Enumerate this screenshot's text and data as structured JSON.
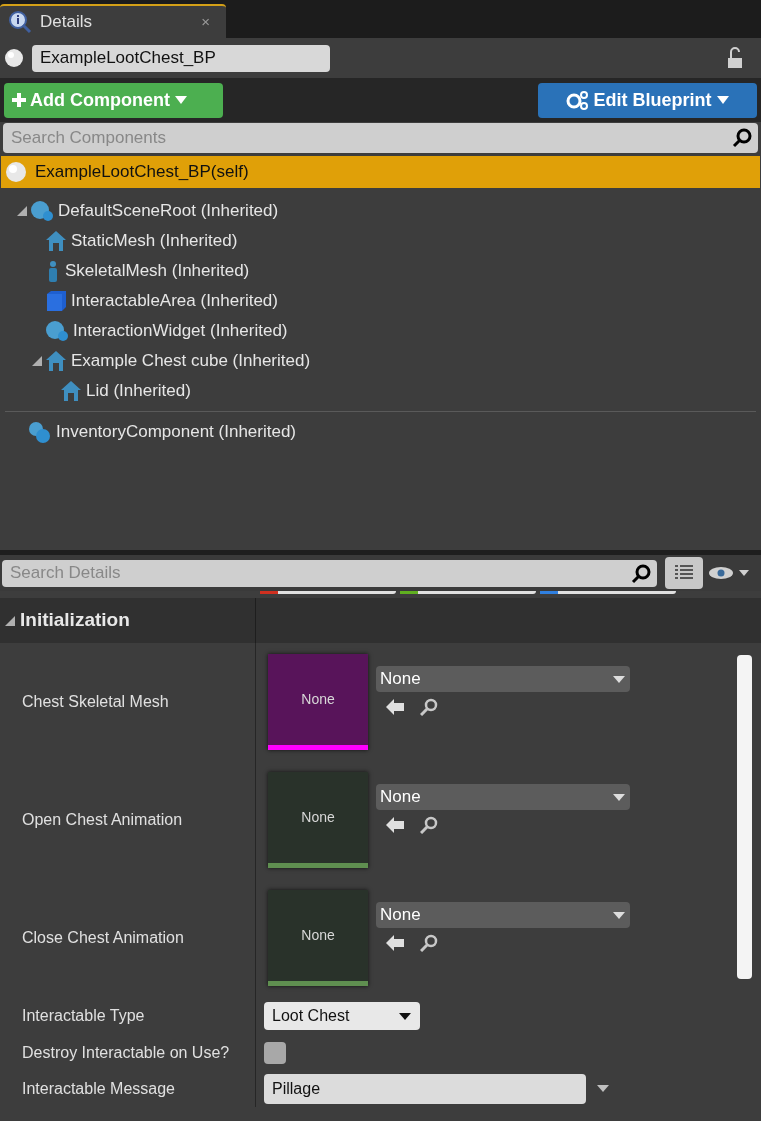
{
  "tab": {
    "title": "Details",
    "close": "×"
  },
  "object_name": {
    "value": "ExampleLootChest_BP",
    "locked": false
  },
  "add_button": {
    "label": "Add Component"
  },
  "edit_button": {
    "label": "Edit Blueprint"
  },
  "component_search": {
    "placeholder": "Search Components"
  },
  "self_row": {
    "label": "ExampleLootChest_BP(self)",
    "selected": true
  },
  "tree": [
    {
      "label": "DefaultSceneRoot (Inherited)",
      "kind": "sphere",
      "expanded": true,
      "children": [
        {
          "label": "StaticMesh (Inherited)",
          "kind": "mesh"
        },
        {
          "label": "SkeletalMesh (Inherited)",
          "kind": "skeletal"
        },
        {
          "label": "InteractableArea (Inherited)",
          "kind": "box"
        },
        {
          "label": "InteractionWidget (Inherited)",
          "kind": "sphere"
        },
        {
          "label": "Example Chest cube (Inherited)",
          "kind": "mesh",
          "expanded": true,
          "children": [
            {
              "label": "Lid (Inherited)",
              "kind": "mesh"
            }
          ]
        }
      ]
    }
  ],
  "other_components": [
    {
      "label": "InventoryComponent (Inherited)",
      "kind": "actor"
    }
  ],
  "details_search": {
    "placeholder": "Search Details"
  },
  "category": {
    "label": "Initialization",
    "expanded": true
  },
  "properties": [
    {
      "kind": "asset",
      "label": "Chest Skeletal Mesh",
      "thumb": "None",
      "value": "None",
      "color": "#ff00ff"
    },
    {
      "kind": "asset",
      "label": "Open Chest Animation",
      "thumb": "None",
      "value": "None",
      "color": "#5f8f50"
    },
    {
      "kind": "asset",
      "label": "Close Chest Animation",
      "thumb": "None",
      "value": "None",
      "color": "#5f8f50"
    },
    {
      "kind": "dropdown",
      "label": "Interactable Type",
      "value": "Loot Chest"
    },
    {
      "kind": "checkbox",
      "label": "Destroy Interactable on Use?",
      "checked": false
    },
    {
      "kind": "text",
      "label": "Interactable Message",
      "value": "Pillage"
    }
  ]
}
